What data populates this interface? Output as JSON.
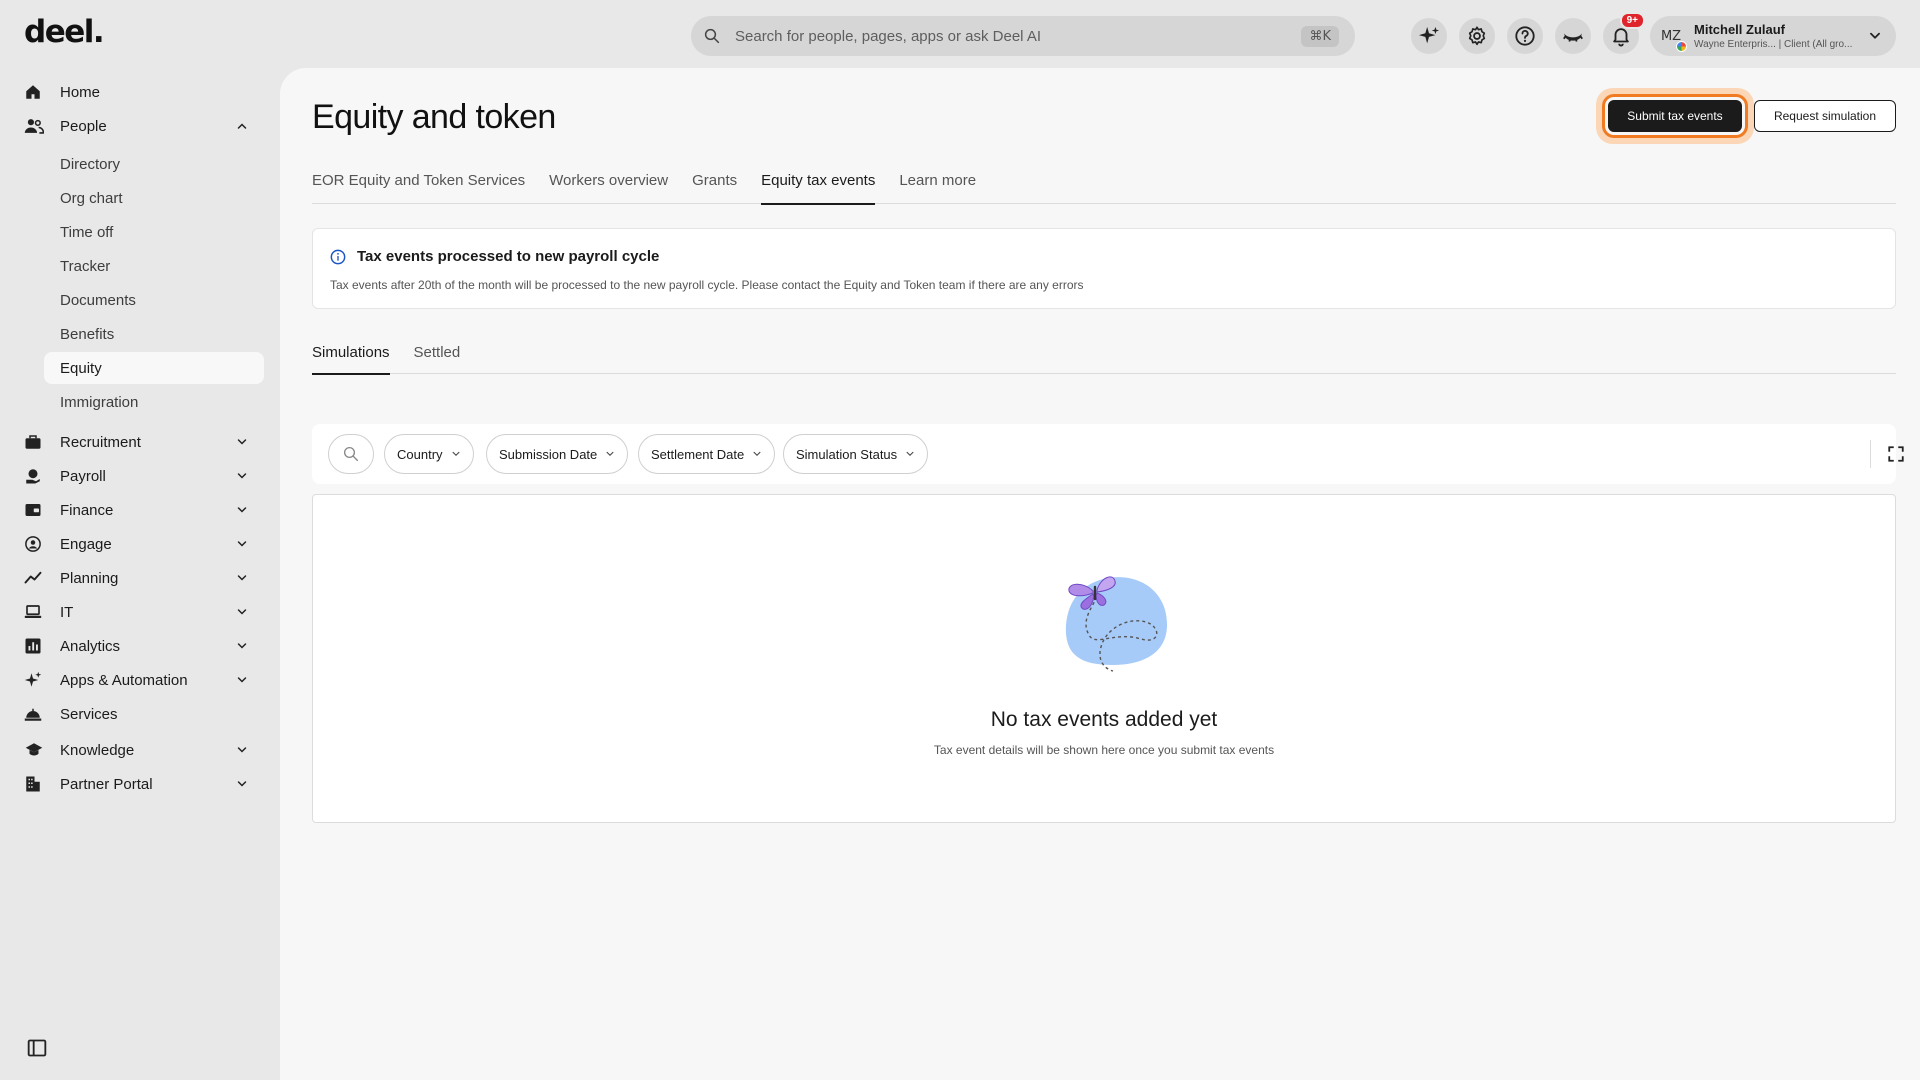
{
  "app": {
    "logo": "deel."
  },
  "search": {
    "placeholder": "Search for people, pages, apps or ask Deel AI",
    "shortcut": "⌘K"
  },
  "notifications": {
    "badge": "9+"
  },
  "user": {
    "initials": "MZ",
    "name": "Mitchell Zulauf",
    "subtitle": "Wayne Enterpris... | Client (All gro..."
  },
  "sidebar": {
    "home": "Home",
    "people": "People",
    "people_items": [
      "Directory",
      "Org chart",
      "Time off",
      "Tracker",
      "Documents",
      "Benefits",
      "Equity",
      "Immigration"
    ],
    "sections": [
      "Recruitment",
      "Payroll",
      "Finance",
      "Engage",
      "Planning",
      "IT",
      "Analytics",
      "Apps & Automation",
      "Services",
      "Knowledge",
      "Partner Portal"
    ]
  },
  "page": {
    "title": "Equity and token",
    "submit_btn": "Submit tax events",
    "request_btn": "Request simulation",
    "tabs": [
      "EOR Equity and Token Services",
      "Workers overview",
      "Grants",
      "Equity tax events",
      "Learn more"
    ],
    "banner": {
      "title": "Tax events processed to new payroll cycle",
      "description": "Tax events after 20th of the month will be processed to the new payroll cycle. Please contact the Equity and Token team if there are any errors"
    },
    "subtabs": [
      "Simulations",
      "Settled"
    ],
    "filters": [
      "Country",
      "Submission Date",
      "Settlement Date",
      "Simulation Status"
    ],
    "empty": {
      "title": "No tax events added yet",
      "subtitle": "Tax event details will be shown here once you submit tax events"
    }
  },
  "colors": {
    "accent_orange": "#f07b22",
    "primary_dark": "#1b1b1b",
    "badge_red": "#e0242b",
    "art_blue": "#a7cbf8",
    "butterfly_purple": "#9b6fe0"
  }
}
